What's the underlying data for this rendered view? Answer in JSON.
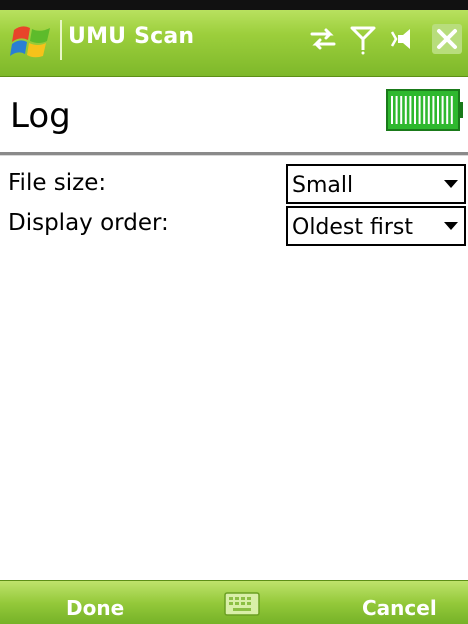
{
  "titlebar": {
    "app_title": "UMU Scan",
    "icons": [
      "windows-start-icon",
      "network-sync-icon",
      "signal-antenna-icon",
      "speaker-volume-icon",
      "close-icon"
    ]
  },
  "header": {
    "title": "Log",
    "battery_icon": "battery-icon",
    "battery_level": 1.0
  },
  "form": {
    "fields": [
      {
        "label": "File size:",
        "value": "Small"
      },
      {
        "label": "Display order:",
        "value": "Oldest first"
      }
    ]
  },
  "menubar": {
    "left_label": "Done",
    "right_label": "Cancel",
    "center_icon": "keyboard-icon"
  },
  "colors": {
    "bar_green": "#9ccf3c",
    "battery_green": "#2eb82e"
  }
}
